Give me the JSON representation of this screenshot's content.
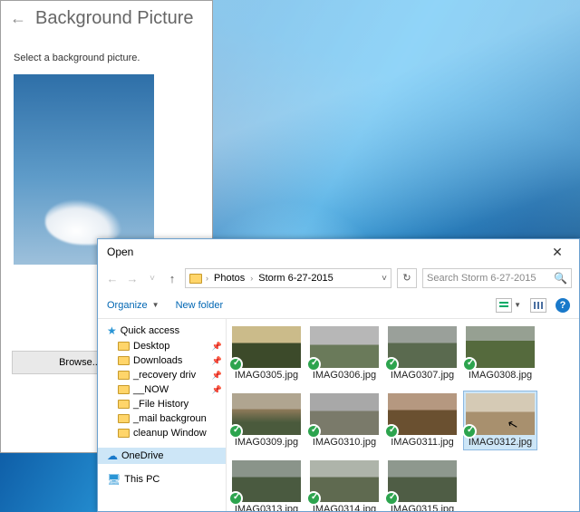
{
  "bg_panel": {
    "title": "Background Picture",
    "subtitle": "Select a background picture.",
    "browse_label": "Browse..."
  },
  "dialog": {
    "title": "Open",
    "breadcrumb": {
      "root_icon": "folder-icon",
      "items": [
        "Photos",
        "Storm 6-27-2015"
      ]
    },
    "search_placeholder": "Search Storm 6-27-2015",
    "toolbar": {
      "organize": "Organize",
      "new_folder": "New folder"
    },
    "tree": {
      "quick_access": "Quick access",
      "items": [
        {
          "label": "Desktop",
          "pinned": true
        },
        {
          "label": "Downloads",
          "pinned": true
        },
        {
          "label": "_recovery driv",
          "pinned": true
        },
        {
          "label": "__NOW",
          "pinned": true
        },
        {
          "label": "_File History",
          "pinned": false
        },
        {
          "label": "_mail backgroun",
          "pinned": false
        },
        {
          "label": "cleanup Window",
          "pinned": false
        }
      ],
      "onedrive": "OneDrive",
      "this_pc": "This PC"
    },
    "files": [
      {
        "name": "IMAG0305.jpg",
        "cls": "a"
      },
      {
        "name": "IMAG0306.jpg",
        "cls": "b"
      },
      {
        "name": "IMAG0307.jpg",
        "cls": "c"
      },
      {
        "name": "IMAG0308.jpg",
        "cls": "d"
      },
      {
        "name": "IMAG0309.jpg",
        "cls": "e"
      },
      {
        "name": "IMAG0310.jpg",
        "cls": "f"
      },
      {
        "name": "IMAG0311.jpg",
        "cls": "g"
      },
      {
        "name": "IMAG0312.jpg",
        "cls": "h",
        "selected": true
      },
      {
        "name": "IMAG0313.jpg",
        "cls": "i"
      },
      {
        "name": "IMAG0314.jpg",
        "cls": "j"
      },
      {
        "name": "IMAG0315.jpg",
        "cls": "k"
      }
    ]
  }
}
